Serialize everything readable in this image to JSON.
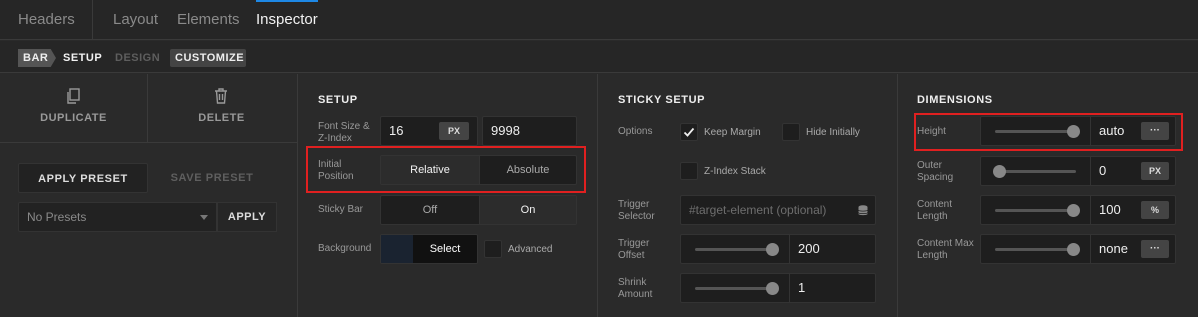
{
  "top_tabs": [
    "Headers",
    "Layout",
    "Elements",
    "Inspector"
  ],
  "breadcrumb": {
    "bar": "BAR",
    "setup": "SETUP",
    "design": "DESIGN",
    "customize": "CUSTOMIZE"
  },
  "left": {
    "duplicate": "DUPLICATE",
    "delete": "DELETE",
    "apply_preset": "APPLY PRESET",
    "save_preset": "SAVE PRESET",
    "presets_select": "No Presets",
    "apply": "APPLY"
  },
  "setup": {
    "title": "SETUP",
    "font_size_label": "Font Size & Z-Index",
    "font_size_value": "16",
    "font_size_unit": "PX",
    "z_index_value": "9998",
    "initial_position_label": "Initial Position",
    "position_options": [
      "Relative",
      "Absolute"
    ],
    "sticky_bar_label": "Sticky Bar",
    "sticky_options": [
      "Off",
      "On"
    ],
    "background_label": "Background",
    "background_select": "Select",
    "advanced_label": "Advanced"
  },
  "sticky": {
    "title": "STICKY SETUP",
    "options_label": "Options",
    "keep_margin": "Keep Margin",
    "hide_initially": "Hide Initially",
    "z_index_stack": "Z-Index Stack",
    "trigger_selector_label": "Trigger Selector",
    "trigger_selector_placeholder": "#target-element (optional)",
    "trigger_offset_label": "Trigger Offset",
    "trigger_offset_value": "200",
    "shrink_amount_label": "Shrink Amount",
    "shrink_amount_value": "1"
  },
  "dimensions": {
    "title": "DIMENSIONS",
    "height_label": "Height",
    "height_value": "auto",
    "outer_spacing_label": "Outer Spacing",
    "outer_spacing_value": "0",
    "outer_spacing_unit": "PX",
    "content_length_label": "Content Length",
    "content_length_value": "100",
    "content_length_unit": "%",
    "content_max_label": "Content Max Length",
    "content_max_value": "none",
    "more": "···"
  },
  "colors": {
    "accent": "#1e88e5",
    "highlight": "#e02020"
  }
}
